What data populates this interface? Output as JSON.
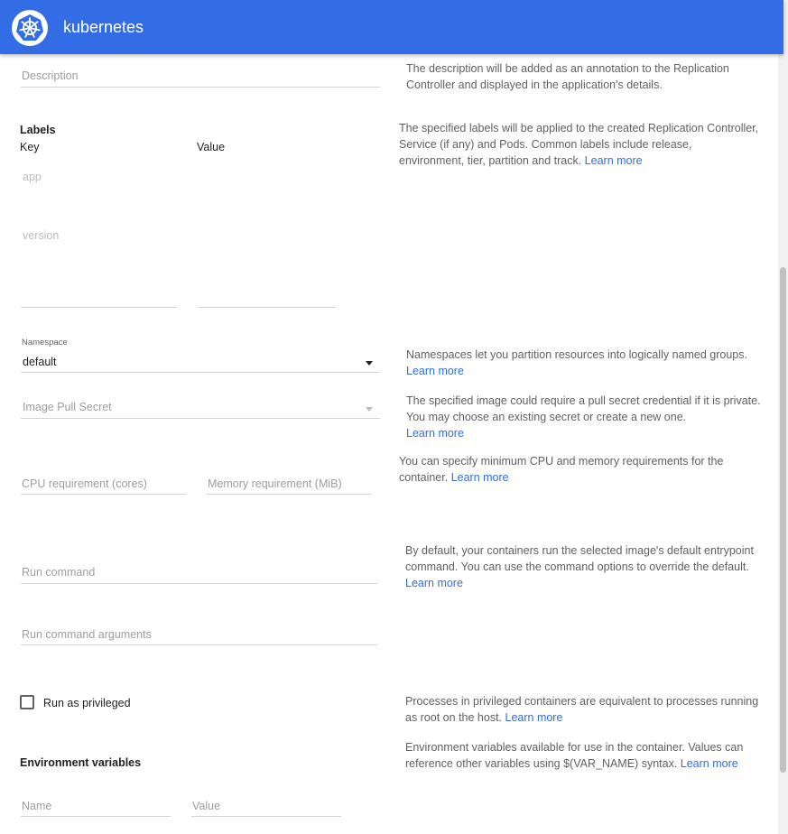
{
  "header": {
    "brand": "kubernetes"
  },
  "description": {
    "placeholder": "Description",
    "help": "The description will be added as an annotation to the Replication Controller and displayed in the application's details."
  },
  "labels": {
    "title": "Labels",
    "key_header": "Key",
    "value_header": "Value",
    "rows": [
      {
        "key": "app"
      },
      {
        "key": "version"
      }
    ],
    "help": "The specified labels will be applied to the created Replication Controller, Service (if any) and Pods. Common labels include release, environment, tier, partition and track.",
    "learn_more": "Learn more"
  },
  "namespace": {
    "label": "Namespace",
    "value": "default",
    "help": "Namespaces let you partition resources into logically named groups.",
    "learn_more": "Learn more"
  },
  "image_pull_secret": {
    "placeholder": "Image Pull Secret",
    "help": "The specified image could require a pull secret credential if it is private. You may choose an existing secret or create a new one.",
    "learn_more": "Learn more"
  },
  "resources": {
    "cpu_placeholder": "CPU requirement (cores)",
    "memory_placeholder": "Memory requirement (MiB)",
    "help": "You can specify minimum CPU and memory requirements for the container.",
    "learn_more": "Learn more"
  },
  "run_command": {
    "placeholder": "Run command",
    "args_placeholder": "Run command arguments",
    "help": "By default, your containers run the selected image's default entrypoint command. You can use the command options to override the default.",
    "learn_more": "Learn more"
  },
  "privileged": {
    "label": "Run as privileged",
    "checked": false,
    "help": "Processes in privileged containers are equivalent to processes running as root on the host.",
    "learn_more": "Learn more"
  },
  "env": {
    "title": "Environment variables",
    "name_placeholder": "Name",
    "value_placeholder": "Value",
    "help": "Environment variables available for use in the container. Values can reference other variables using $(VAR_NAME) syntax.",
    "learn_more": "Learn more"
  },
  "colors": {
    "primary": "#326de6",
    "link": "#326de6"
  }
}
